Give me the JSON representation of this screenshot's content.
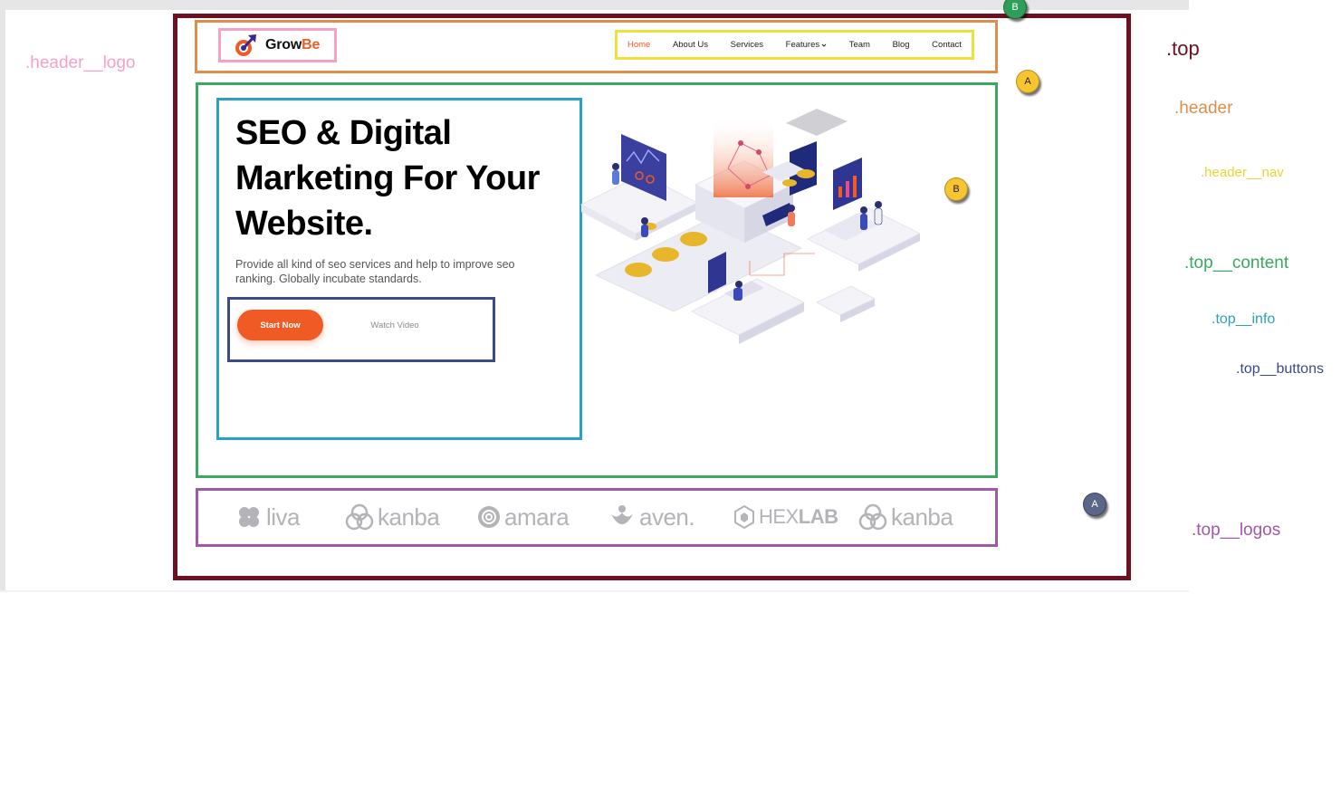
{
  "brand": {
    "name_part1": "Grow",
    "name_part2": "Be",
    "accent_color": "#f05a24"
  },
  "nav": {
    "items": [
      {
        "label": "Home",
        "active": true
      },
      {
        "label": "About Us",
        "active": false
      },
      {
        "label": "Services",
        "active": false
      },
      {
        "label": "Features",
        "active": false,
        "has_dropdown": true
      },
      {
        "label": "Team",
        "active": false
      },
      {
        "label": "Blog",
        "active": false
      },
      {
        "label": "Contact",
        "active": false
      }
    ]
  },
  "hero": {
    "title": "SEO & Digital Marketing For Your Website.",
    "text": "Provide all kind of seo services and help to improve seo ranking. Globally incubate standards.",
    "primary_button": "Start Now",
    "secondary_button": "Watch Video"
  },
  "partner_logos": [
    {
      "name": "liva",
      "icon": "flower-icon"
    },
    {
      "name": "kanba",
      "icon": "trefoil-icon"
    },
    {
      "name": "amara",
      "icon": "at-circle-icon"
    },
    {
      "name": "aven.",
      "icon": "leaf-cup-icon"
    },
    {
      "name_light": "HEX",
      "name_bold": "LAB",
      "icon": "hexagon-icon"
    },
    {
      "name": "kanba",
      "icon": "trefoil-icon"
    }
  ],
  "annotations": {
    "top": ".top",
    "header": ".header",
    "header_nav": ".header__nav",
    "header_logo": ".header__logo",
    "top_content": ".top__content",
    "top_info": ".top__info",
    "top_buttons": ".top__buttons",
    "top_logos": ".top__logos"
  },
  "markers": {
    "b_top": "B",
    "a_content": "A",
    "b_content": "B",
    "a_logos": "A"
  },
  "colors": {
    "top_border": "#6e0f22",
    "header_border": "#e08d4b",
    "logo_border": "#f4a1c4",
    "nav_border": "#f0e13a",
    "content_border": "#3aa860",
    "info_border": "#2aa1c4",
    "buttons_border": "#3d4a8a",
    "logos_border": "#a158a6"
  }
}
